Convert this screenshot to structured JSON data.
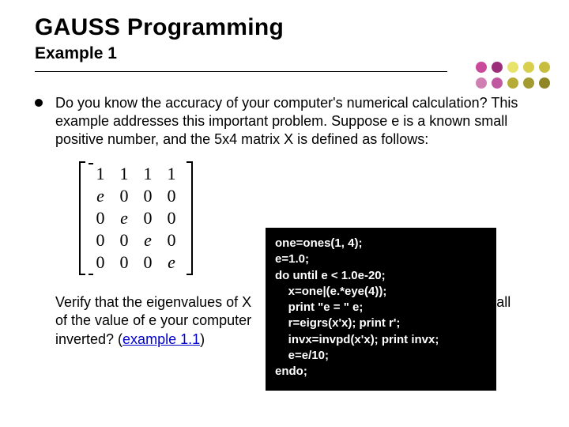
{
  "title": "GAUSS Programming",
  "subtitle": "Example 1",
  "bullet_text": "Do you know the accuracy of your computer's numerical calculation? This example addresses this important problem. Suppose e is a known small positive number, and the 5x4 matrix X is defined as follows:",
  "matrix": [
    [
      "1",
      "1",
      "1",
      "1"
    ],
    [
      "e",
      "0",
      "0",
      "0"
    ],
    [
      "0",
      "e",
      "0",
      "0"
    ],
    [
      "0",
      "0",
      "e",
      "0"
    ],
    [
      "0",
      "0",
      "0",
      "e"
    ]
  ],
  "para2_before": "Verify that the eigenvalues of X",
  "para2_mid": "of the value of e your computer",
  "para2_after_inv": "inverted? (",
  "link_text": "example 1.1",
  "para2_close": ")",
  "para2_tail": "all",
  "code": "one=ones(1, 4);\ne=1.0;\ndo until e < 1.0e-20;\n    x=one|(e.*eye(4));\n    print \"e = \" e;\n    r=eigrs(x'x); print r';\n    invx=invpd(x'x); print invx;\n    e=e/10;\nendo;",
  "dot_colors": [
    "#c94a9a",
    "#9b2e7a",
    "#e7e36b",
    "#d8cf4c",
    "#c7bd3e",
    "#d07fb2",
    "#c059a0",
    "#b7ab38",
    "#a39a30",
    "#8f8628"
  ]
}
